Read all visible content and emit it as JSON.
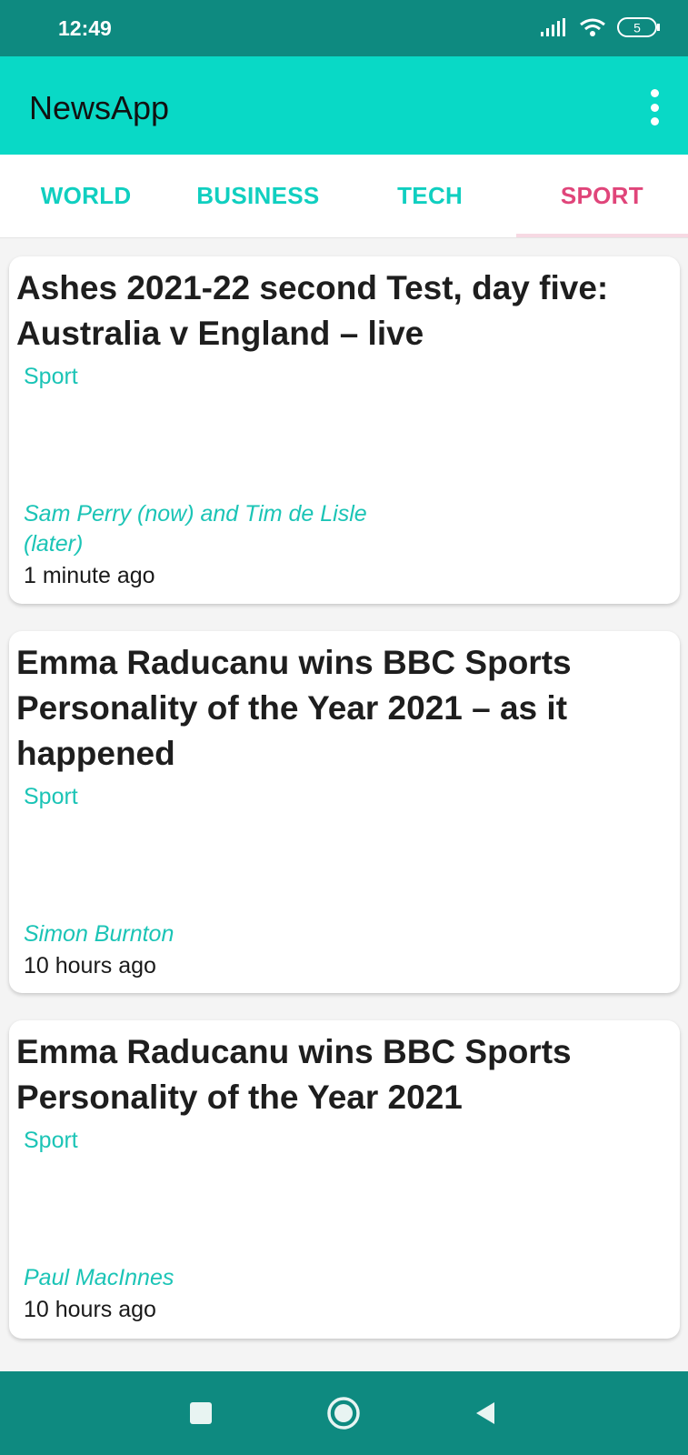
{
  "status_bar": {
    "time": "12:49",
    "battery": "5",
    "icons": [
      "signal-icon",
      "wifi-icon",
      "battery-icon"
    ]
  },
  "app_bar": {
    "title": "NewsApp",
    "menu_icon": "overflow-menu-icon"
  },
  "tabs": [
    {
      "label": "WORLD",
      "active": false
    },
    {
      "label": "BUSINESS",
      "active": false
    },
    {
      "label": "TECH",
      "active": false
    },
    {
      "label": "SPORT",
      "active": true
    }
  ],
  "articles": [
    {
      "title": "Ashes 2021-22 second Test, day five: Australia v England – live",
      "section": "Sport",
      "author": "Sam Perry (now) and Tim de Lisle (later)",
      "time": "1 minute ago"
    },
    {
      "title": "Emma Raducanu wins BBC Sports Personality of the Year 2021 – as it happened",
      "section": "Sport",
      "author": "Simon Burnton",
      "time": "10 hours ago"
    },
    {
      "title": "Emma Raducanu wins BBC Sports Personality of the Year 2021",
      "section": "Sport",
      "author": "Paul MacInnes",
      "time": "10 hours ago"
    }
  ],
  "nav_bar": {
    "icons": [
      "recents-square-icon",
      "home-circle-icon",
      "back-triangle-icon"
    ]
  },
  "colors": {
    "status_bar": "#0e8a80",
    "app_bar": "#09d9c6",
    "tab_text": "#10cfc0",
    "tab_active": "#e0457a",
    "accent_text": "#1bc4b6"
  }
}
